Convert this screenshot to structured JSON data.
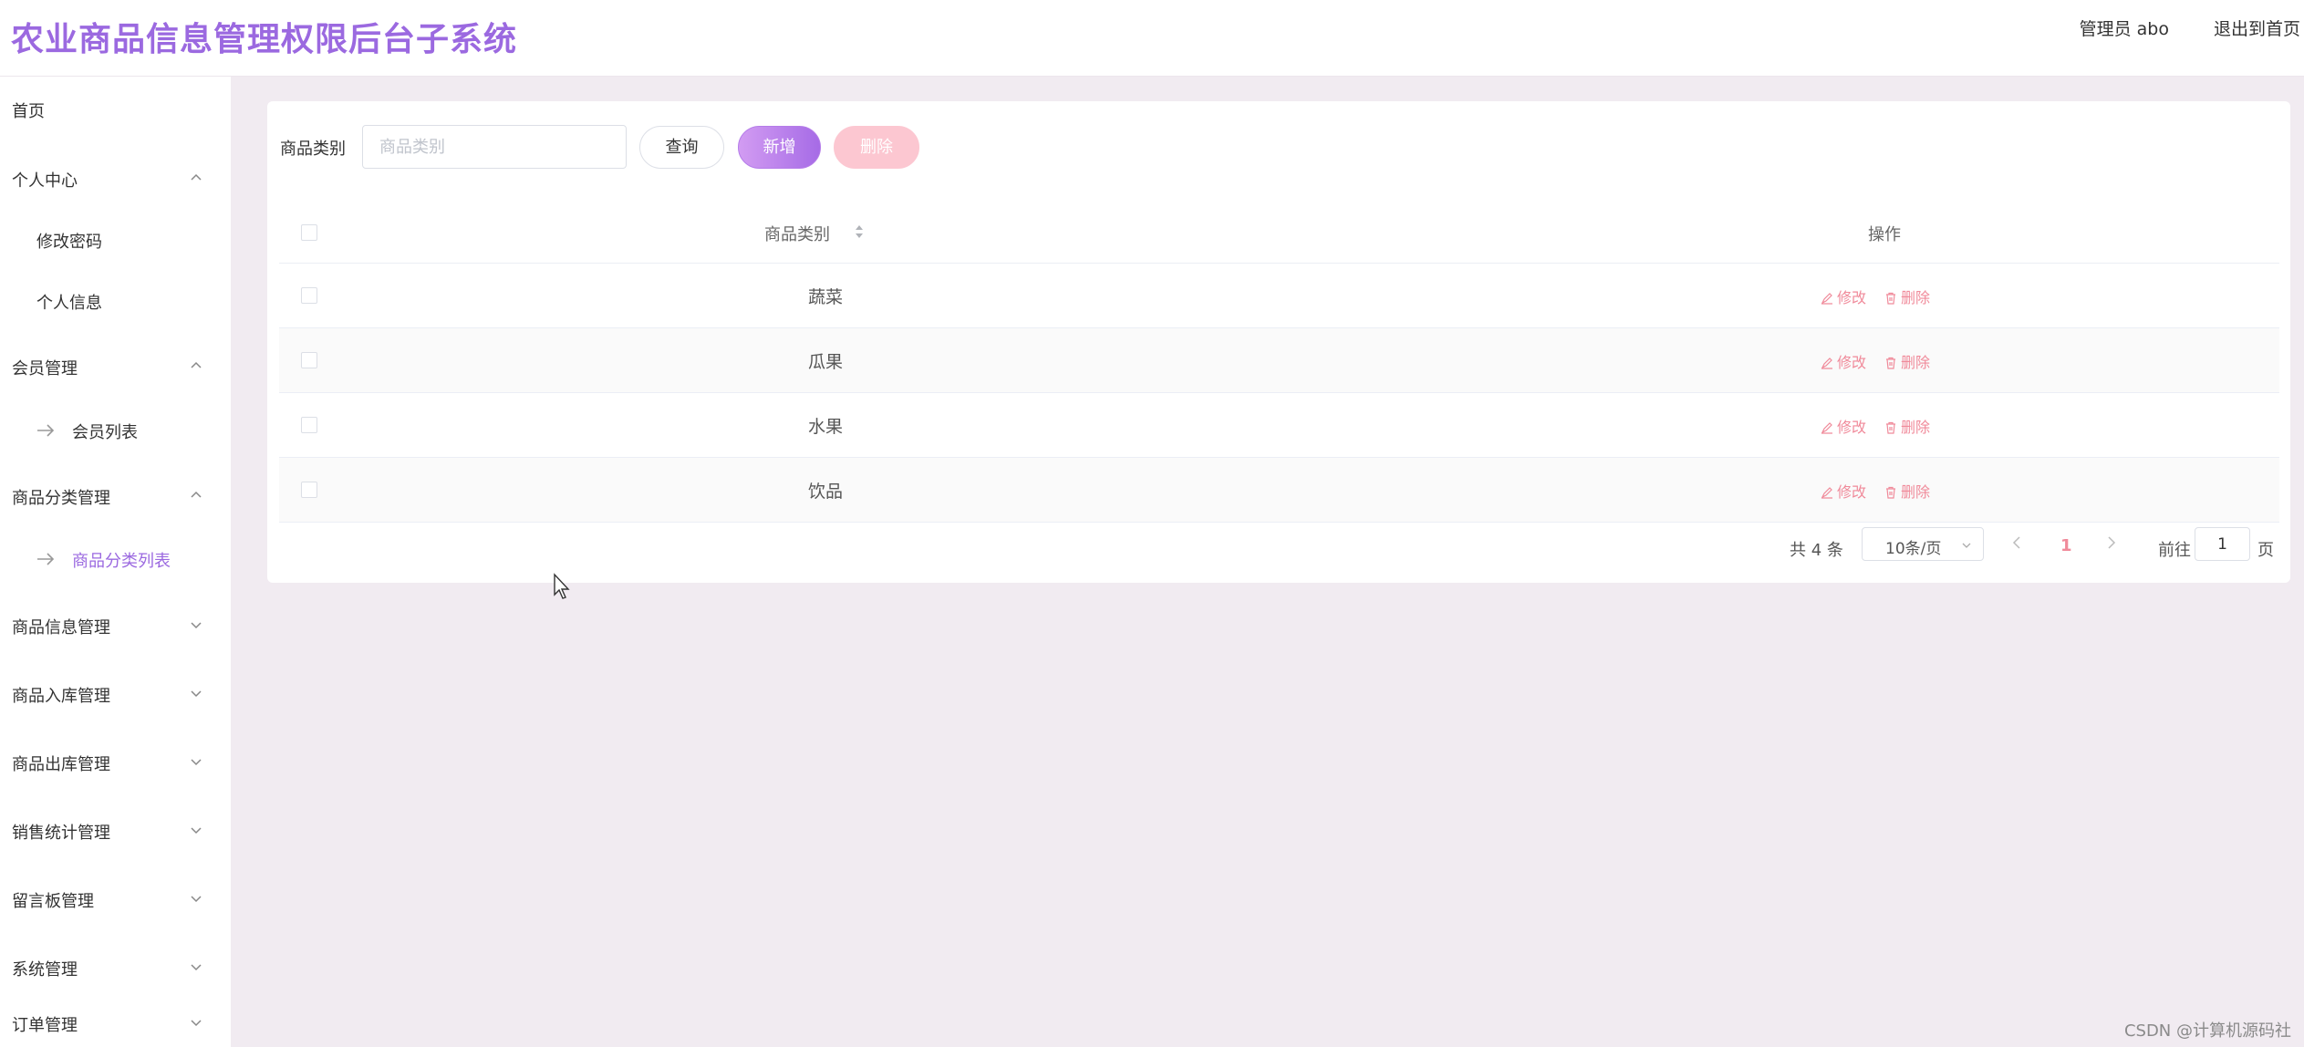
{
  "header": {
    "app_title": "农业商品信息管理权限后台子系统",
    "user_label": "管理员 abo",
    "logout_label": "退出到首页"
  },
  "sidebar": {
    "home": "首页",
    "personal_center": "个人中心",
    "change_password": "修改密码",
    "personal_info": "个人信息",
    "member_mgmt": "会员管理",
    "member_list": "会员列表",
    "category_mgmt": "商品分类管理",
    "category_list": "商品分类列表",
    "product_info_mgmt": "商品信息管理",
    "stock_in_mgmt": "商品入库管理",
    "stock_out_mgmt": "商品出库管理",
    "sales_stats_mgmt": "销售统计管理",
    "message_board_mgmt": "留言板管理",
    "system_mgmt": "系统管理",
    "order_mgmt": "订单管理"
  },
  "search": {
    "label": "商品类别",
    "placeholder": "商品类别",
    "query_label": "查询",
    "add_label": "新增",
    "delete_label": "删除"
  },
  "table": {
    "col_category": "商品类别",
    "col_actions": "操作",
    "edit_label": "修改",
    "delete_label": "删除",
    "rows": [
      "蔬菜",
      "瓜果",
      "水果",
      "饮品"
    ]
  },
  "pagination": {
    "total": "共 4 条",
    "page_size": "10条/页",
    "current_page": "1",
    "goto_label": "前往",
    "goto_value": "1",
    "page_unit": "页"
  },
  "watermark": "CSDN @计算机源码社",
  "colors": {
    "accent": "#9b69e0",
    "danger_text": "#f08a9a",
    "background": "#f1ebf1"
  }
}
